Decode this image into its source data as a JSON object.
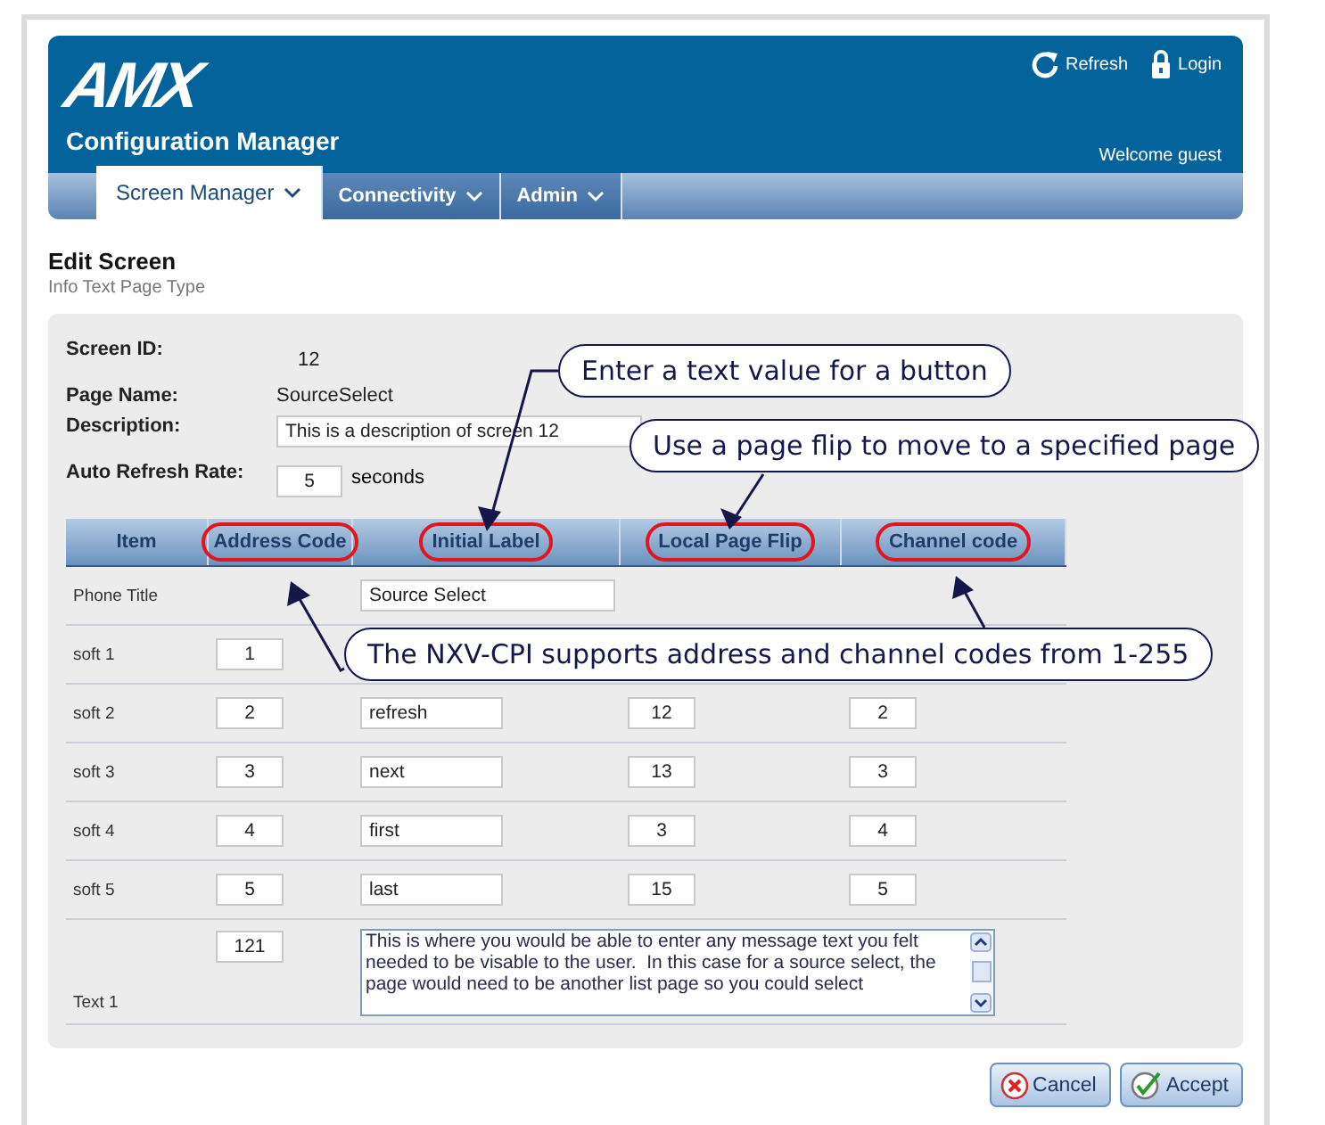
{
  "header": {
    "logo": "AMX",
    "app_title": "Configuration Manager",
    "actions": [
      "Refresh",
      "Login"
    ],
    "welcome": "Welcome guest"
  },
  "nav": [
    {
      "label": "Screen Manager",
      "selected": true
    },
    {
      "label": "Connectivity",
      "selected": false
    },
    {
      "label": "Admin",
      "selected": false
    }
  ],
  "page": {
    "title": "Edit Screen",
    "subtitle": "Info Text Page Type"
  },
  "form": {
    "screen_id_label": "Screen ID:",
    "screen_id": "12",
    "page_name_label": "Page Name:",
    "page_name": "SourceSelect",
    "description_label": "Description:",
    "description": "This is a description of screen 12",
    "refresh_label": "Auto Refresh Rate:",
    "refresh_value": "5",
    "refresh_unit": "seconds"
  },
  "table": {
    "columns": [
      {
        "label": "Item",
        "highlighted": false
      },
      {
        "label": "Address Code",
        "highlighted": true
      },
      {
        "label": "Initial Label",
        "highlighted": true
      },
      {
        "label": "Local Page Flip",
        "highlighted": true
      },
      {
        "label": "Channel code",
        "highlighted": true
      }
    ],
    "rows": [
      {
        "item": "Phone Title",
        "initial_label": "Source Select",
        "kind": "wide"
      },
      {
        "item": "soft 1",
        "address_code": "1",
        "kind": "button"
      },
      {
        "item": "soft 2",
        "address_code": "2",
        "initial_label": "refresh",
        "page_flip": "12",
        "channel_code": "2",
        "kind": "button"
      },
      {
        "item": "soft 3",
        "address_code": "3",
        "initial_label": "next",
        "page_flip": "13",
        "channel_code": "3",
        "kind": "button"
      },
      {
        "item": "soft 4",
        "address_code": "4",
        "initial_label": "first",
        "page_flip": "3",
        "channel_code": "4",
        "kind": "button"
      },
      {
        "item": "soft 5",
        "address_code": "5",
        "initial_label": "last",
        "page_flip": "15",
        "channel_code": "5",
        "kind": "button"
      },
      {
        "item": "Text 1",
        "address_code": "121",
        "message": "This is where you would be able to enter any message text you felt needed to be visable to the user.  In this case for a source select, the page would need to be another list page so you could select",
        "kind": "text"
      }
    ]
  },
  "buttons": [
    "Cancel",
    "Accept"
  ],
  "callouts": [
    "Enter a text value for a button",
    "Use a page flip to move to a specified page",
    "The NXV-CPI supports address and channel codes from 1-255"
  ]
}
